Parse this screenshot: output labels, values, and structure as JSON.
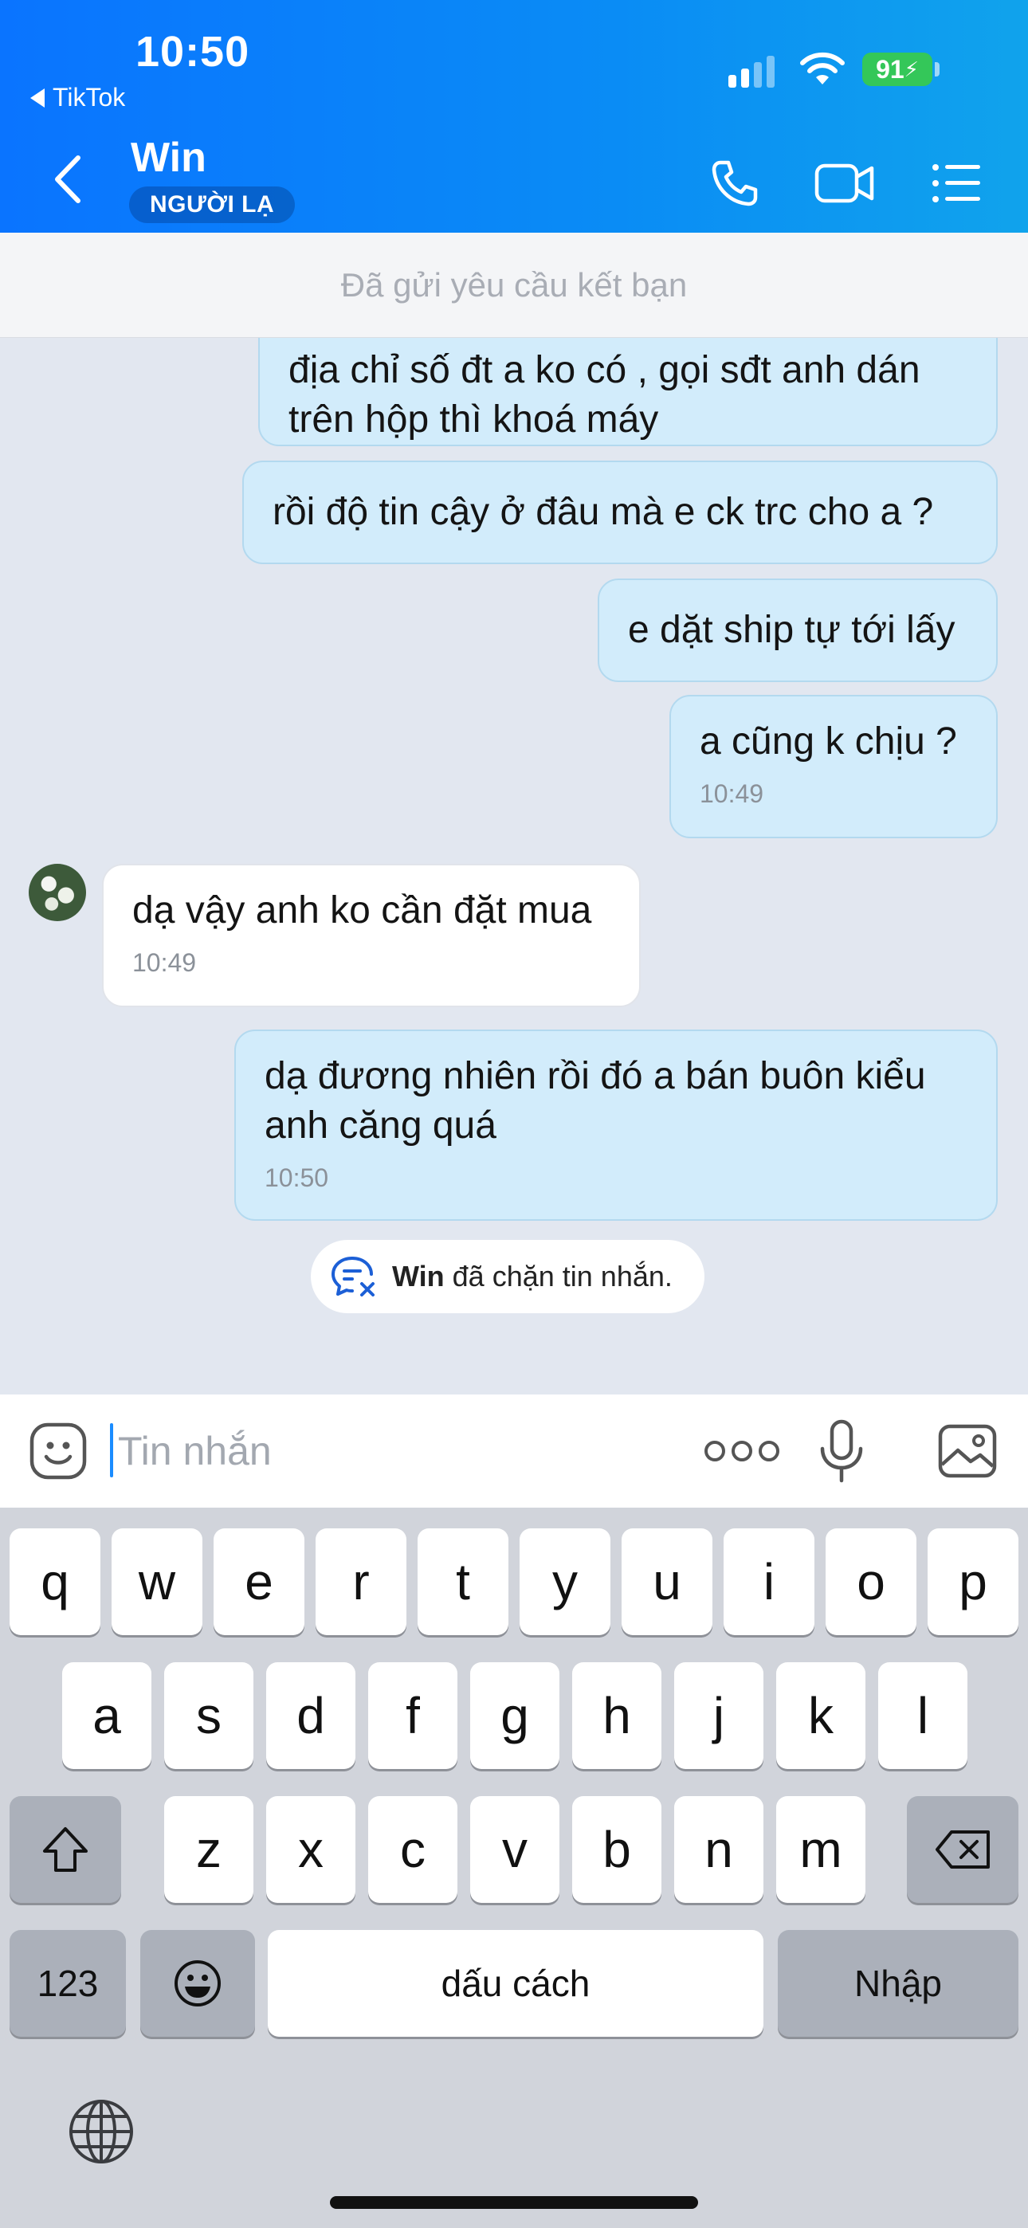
{
  "status_bar": {
    "time": "10:50",
    "back_app": "TikTok",
    "battery": "91"
  },
  "header": {
    "contact_name": "Win",
    "badge": "NGƯỜI LẠ"
  },
  "friend_request": {
    "text": "Đã gửi yêu cầu kết bạn"
  },
  "messages": [
    {
      "side": "me",
      "text": "địa chỉ số đt a ko có , gọi sđt anh dán trên hộp thì khoá máy"
    },
    {
      "side": "me",
      "text": "rồi độ tin cậy ở đâu mà e ck trc cho a ?"
    },
    {
      "side": "me",
      "text": "e dặt ship tự tới lấy"
    },
    {
      "side": "me",
      "text": "a cũng k chịu ?",
      "time": "10:49"
    },
    {
      "side": "them",
      "text": "dạ vậy anh ko cần đặt mua",
      "time": "10:49"
    },
    {
      "side": "me",
      "text": "dạ đương nhiên rồi đó a bán buôn kiểu anh căng quá",
      "time": "10:50"
    }
  ],
  "system_notice": {
    "name": "Win",
    "text": " đã chặn tin nhắn."
  },
  "composer": {
    "placeholder": "Tin nhắn"
  },
  "keyboard": {
    "row1": [
      "q",
      "w",
      "e",
      "r",
      "t",
      "y",
      "u",
      "i",
      "o",
      "p"
    ],
    "row2": [
      "a",
      "s",
      "d",
      "f",
      "g",
      "h",
      "j",
      "k",
      "l"
    ],
    "row3": [
      "z",
      "x",
      "c",
      "v",
      "b",
      "n",
      "m"
    ],
    "numbers_key": "123",
    "space_key": "dấu cách",
    "return_key": "Nhập"
  },
  "colors": {
    "header_start": "#0a74ff",
    "header_end": "#10a3ec",
    "my_bubble": "#d2ecfb",
    "their_bubble": "#ffffff",
    "battery": "#34c759"
  },
  "icons": [
    "back-arrow-icon",
    "phone-icon",
    "video-icon",
    "menu-icon",
    "block-message-icon",
    "emoji-icon",
    "more-icon",
    "mic-icon",
    "image-icon",
    "shift-icon",
    "backspace-icon",
    "emoji-key-icon",
    "globe-icon"
  ]
}
